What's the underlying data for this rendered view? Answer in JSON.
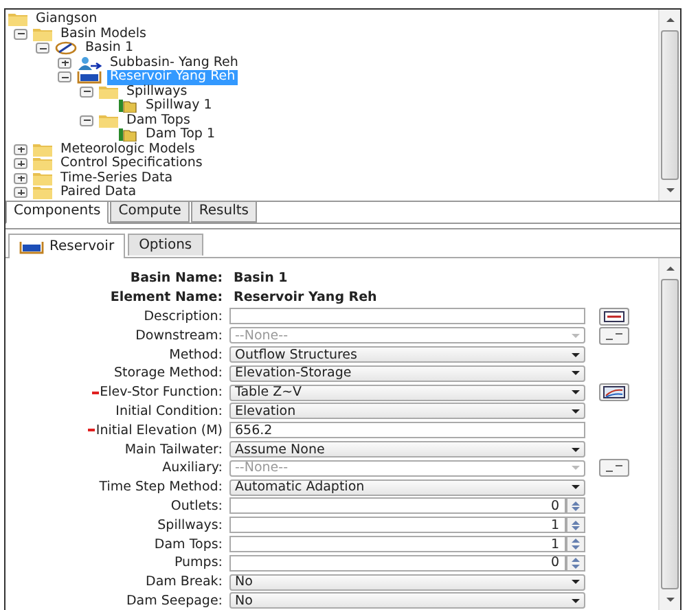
{
  "tree": [
    {
      "label": "Giangson",
      "kind": "folder",
      "children": [
        {
          "label": "Basin Models",
          "kind": "folder",
          "expanded": true,
          "selected": false,
          "children": [
            {
              "label": "Basin 1",
              "kind": "basin",
              "expanded": true,
              "selected": false,
              "children": [
                {
                  "label": "Subbasin- Yang Reh",
                  "kind": "subbasin",
                  "expanded": false,
                  "selected": false
                },
                {
                  "label": "Reservoir Yang Reh",
                  "kind": "reservoir",
                  "expanded": true,
                  "selected": true,
                  "children": [
                    {
                      "label": "Spillways",
                      "kind": "folder",
                      "expanded": true,
                      "selected": false,
                      "children": [
                        {
                          "label": "Spillway 1",
                          "kind": "structure",
                          "selected": false
                        }
                      ]
                    },
                    {
                      "label": "Dam Tops",
                      "kind": "folder",
                      "expanded": true,
                      "selected": false,
                      "children": [
                        {
                          "label": "Dam Top 1",
                          "kind": "structure",
                          "selected": false
                        }
                      ]
                    }
                  ]
                }
              ]
            }
          ]
        },
        {
          "label": "Meteorologic Models",
          "kind": "folder",
          "expanded": false,
          "selected": false
        },
        {
          "label": "Control Specifications",
          "kind": "folder",
          "expanded": false,
          "selected": false
        },
        {
          "label": "Time-Series Data",
          "kind": "folder",
          "expanded": false,
          "selected": false
        },
        {
          "label": "Paired Data",
          "kind": "folder",
          "expanded": false,
          "selected": false
        }
      ]
    }
  ],
  "bottom_tabs": [
    {
      "label": "Components",
      "selected": true
    },
    {
      "label": "Compute",
      "selected": false
    },
    {
      "label": "Results",
      "selected": false
    }
  ],
  "editor_tabs": [
    {
      "label": "Reservoir",
      "selected": true,
      "kind": "reservoir"
    },
    {
      "label": "Options",
      "selected": false,
      "kind": "plain"
    }
  ],
  "header": [
    {
      "label": "Basin Name:",
      "value": "Basin 1"
    },
    {
      "label": "Element Name:",
      "value": "Reservoir Yang Reh"
    }
  ],
  "fields": [
    {
      "label": "Description:",
      "kind": "text",
      "side_button": {
        "kind": "notes"
      }
    },
    {
      "label": "Downstream:",
      "kind": "dropdown",
      "value": "--None--",
      "disabled": true,
      "side_button": {
        "kind": "list"
      }
    },
    {
      "label": "Method:",
      "kind": "dropdown",
      "value": "Outflow Structures",
      "disabled": false
    },
    {
      "label": "Storage Method:",
      "kind": "dropdown",
      "value": "Elevation-Storage",
      "disabled": false
    },
    {
      "label": "Elev-Stor Function:",
      "kind": "dropdown",
      "value": "Table Z~V",
      "required": true,
      "disabled": false,
      "side_button": {
        "kind": "graph"
      }
    },
    {
      "label": "Initial Condition:",
      "kind": "dropdown",
      "value": "Elevation",
      "disabled": false
    },
    {
      "label": "Initial Elevation (M)",
      "kind": "text",
      "value": "656.2",
      "required": true
    },
    {
      "label": "Main Tailwater:",
      "kind": "dropdown",
      "value": "Assume None",
      "disabled": false
    },
    {
      "label": "Auxiliary:",
      "kind": "dropdown",
      "value": "--None--",
      "disabled": true,
      "side_button": {
        "kind": "list"
      }
    },
    {
      "label": "Time Step Method:",
      "kind": "dropdown",
      "value": "Automatic Adaption",
      "disabled": false
    },
    {
      "label": "Outlets:",
      "kind": "spinner",
      "value": "0"
    },
    {
      "label": "Spillways:",
      "kind": "spinner",
      "value": "1"
    },
    {
      "label": "Dam Tops:",
      "kind": "spinner",
      "value": "1"
    },
    {
      "label": "Pumps:",
      "kind": "spinner",
      "value": "0"
    },
    {
      "label": "Dam Break:",
      "kind": "dropdown",
      "value": "No",
      "disabled": false
    },
    {
      "label": "Dam Seepage:",
      "kind": "dropdown",
      "value": "No",
      "disabled": false
    }
  ]
}
